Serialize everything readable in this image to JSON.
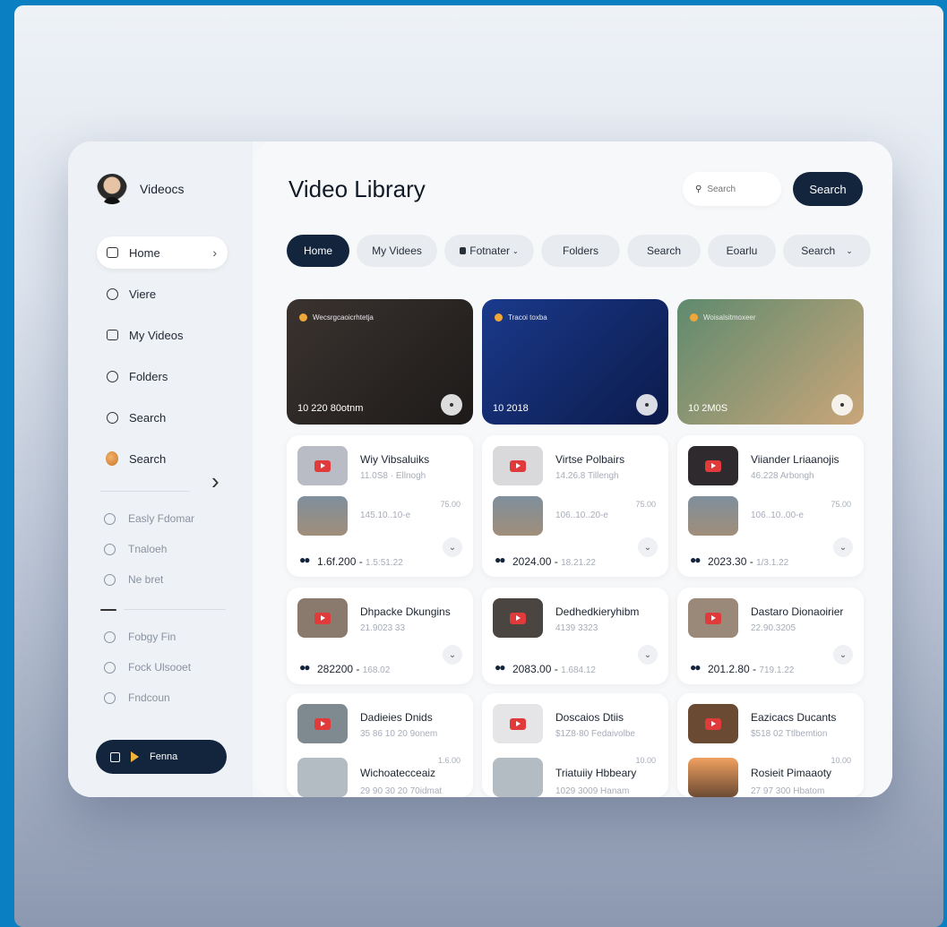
{
  "profile": {
    "name": "Videocs"
  },
  "nav": [
    {
      "label": "Home",
      "icon": "home-icon"
    },
    {
      "label": "Viere",
      "icon": "thumb-icon"
    },
    {
      "label": "My Videos",
      "icon": "video-icon"
    },
    {
      "label": "Folders",
      "icon": "folder-icon"
    },
    {
      "label": "Search",
      "icon": "search-icon"
    },
    {
      "label": "Search",
      "icon": "avatar-icon"
    }
  ],
  "secondary": [
    "Easly Fdomar",
    "Tnaloeh",
    "Ne bret"
  ],
  "tertiary": [
    "Fobgy Fin",
    "Fock Ulsooet",
    "Fndcoun"
  ],
  "play_button": {
    "label": "Fenna"
  },
  "header": {
    "title": "Video Library",
    "search_placeholder": "Search",
    "search_button": "Search"
  },
  "tabs": [
    "Home",
    "My Videes",
    "Fotnater",
    "Folders",
    "Search",
    "Eoarlu",
    "Search"
  ],
  "featured": [
    {
      "label": "Wecsrgcaoicrhtetja",
      "count": "10  220 80otnm",
      "colors": [
        "#3a3330",
        "#1d1a19"
      ]
    },
    {
      "label": "Tracoi toxba",
      "count": "10  2018",
      "colors": [
        "#1b3a8c",
        "#0b1a4a"
      ]
    },
    {
      "label": "Woisalsitmoxeer",
      "count": "10  2M0S",
      "colors": [
        "#5f8a6e",
        "#caa67a"
      ]
    }
  ],
  "cards": [
    {
      "title": "Wiy Vibsaluiks",
      "sub": "11.0S8 · Ellnogh",
      "title2": "",
      "sub2": "145.10..10-e",
      "dur": "75.00",
      "date": "1.6f.200",
      "date_sub": "1.5:51.22"
    },
    {
      "title": "Virtse Polbairs",
      "sub": "14.26.8  Tillengh",
      "title2": "",
      "sub2": "106..10..20-e",
      "dur": "75.00",
      "date": "2024.00",
      "date_sub": "18.21.22"
    },
    {
      "title": "Viiander Lriaanojis",
      "sub": "46.228  Arbongh",
      "title2": "",
      "sub2": "106..10..00-e",
      "dur": "75.00",
      "date": "2023.30",
      "date_sub": "1/3.1.22"
    },
    {
      "title": "Dhpacke Dkungins",
      "sub": "21.9023 33",
      "title2": "",
      "sub2": "",
      "dur": "",
      "date": "282200",
      "date_sub": "168.02"
    },
    {
      "title": "Dedhedkieryhibm",
      "sub": "4139 3323",
      "title2": "",
      "sub2": "",
      "dur": "",
      "date": "2083.00",
      "date_sub": "1.684.12"
    },
    {
      "title": "Dastaro Dionaoirier",
      "sub": "22.90.3205",
      "title2": "",
      "sub2": "",
      "dur": "",
      "date": "201.2.80",
      "date_sub": "719.1.22"
    },
    {
      "title": "Dadieies Dnids",
      "sub": "35 86 10  20 9onem",
      "title2": "Wichoatecceaiz",
      "sub2": "29 90 30  20 70idmat",
      "dur": "1.6.00",
      "date": "",
      "date_sub": ""
    },
    {
      "title": "Doscaios Dtiis",
      "sub": "$1Z8·80  Fedaivolbe",
      "title2": "Triatuiiy Hbbeary",
      "sub2": "1029 3009  Hanam",
      "dur": "10.00",
      "date": "",
      "date_sub": ""
    },
    {
      "title": "Eazicacs Ducants",
      "sub": "$518 02  Ttlbemtion",
      "title2": "Rosieit Pimaaoty",
      "sub2": "27 97 300  Hbatom",
      "dur": "10.00",
      "date": "",
      "date_sub": ""
    }
  ]
}
